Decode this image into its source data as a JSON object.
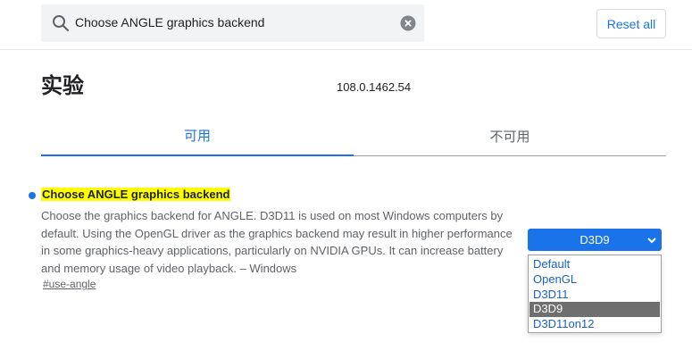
{
  "search": {
    "query": "Choose ANGLE graphics backend",
    "search_icon": "search-icon",
    "clear_icon": "clear-icon"
  },
  "header": {
    "reset_label": "Reset all"
  },
  "page": {
    "title": "实验",
    "version": "108.0.1462.54"
  },
  "tabs": [
    {
      "label": "可用",
      "active": true
    },
    {
      "label": "不可用",
      "active": false
    }
  ],
  "experiment": {
    "name": "Choose ANGLE graphics backend",
    "description": "Choose the graphics backend for ANGLE. D3D11 is used on most Windows computers by default. Using the OpenGL driver as the graphics backend may result in higher performance in some graphics-heavy applications, particularly on NVIDIA GPUs. It can increase battery and memory usage of video playback. – Windows",
    "tag": "#use-angle",
    "selected_value": "D3D9",
    "options": [
      "Default",
      "OpenGL",
      "D3D11",
      "D3D9",
      "D3D11on12"
    ],
    "selected_index": 3
  },
  "colors": {
    "accent": "#1a73e8",
    "highlight": "#ffff00",
    "selected_option_bg": "#6f6f6f"
  }
}
